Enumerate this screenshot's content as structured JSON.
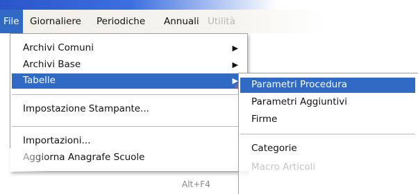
{
  "titlebar": {
    "text": ""
  },
  "menubar": {
    "items": [
      {
        "label": "File"
      },
      {
        "label": "Giornaliere"
      },
      {
        "label": "Periodiche"
      },
      {
        "label": "Annuali"
      },
      {
        "label": "Utilità"
      }
    ]
  },
  "file_menu": {
    "items": [
      {
        "label": "Archivi Comuni"
      },
      {
        "label": "Archivi Base"
      },
      {
        "label": "Tabelle"
      },
      {
        "label": "Impostazione Stampante..."
      },
      {
        "label": "Importazioni..."
      },
      {
        "label": "Aggiorna Anagrafe Scuole"
      }
    ],
    "shortcut": "Alt+F4"
  },
  "tabelle_submenu": {
    "items": [
      {
        "label": "Parametri Procedura"
      },
      {
        "label": "Parametri Aggiuntivi"
      },
      {
        "label": "Firme"
      },
      {
        "label": "Categorie"
      },
      {
        "label": "Macro Articoli"
      }
    ]
  },
  "colors": {
    "selection": "#316ac5",
    "highlight_ring": "#ff5a5a"
  },
  "icons": {
    "submenu_arrow": "submenu-arrow-icon"
  }
}
